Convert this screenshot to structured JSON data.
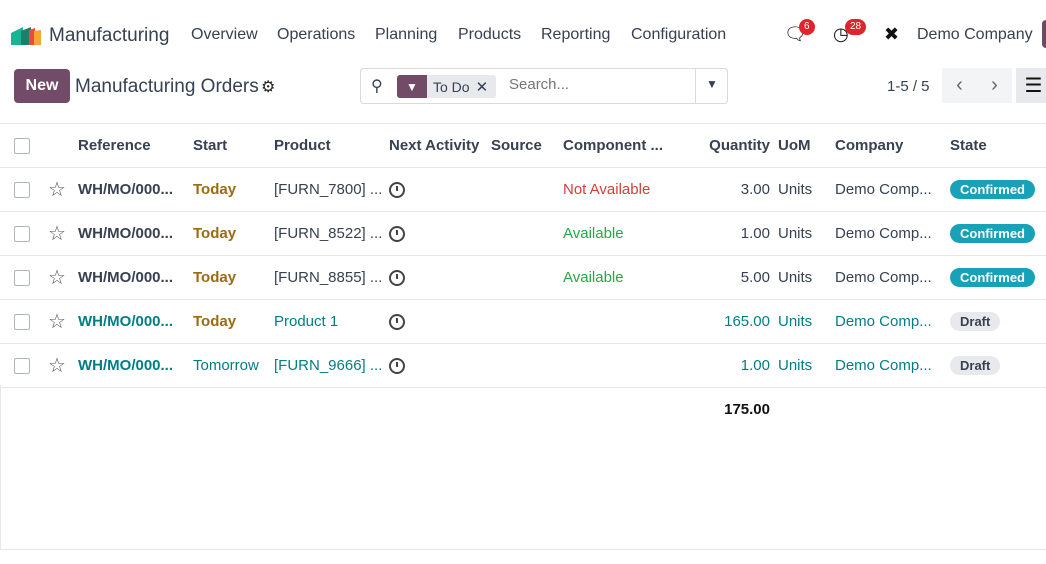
{
  "nav": {
    "app": "Manufacturing",
    "menu": [
      "Overview",
      "Operations",
      "Planning",
      "Products",
      "Reporting",
      "Configuration"
    ],
    "messages_count": "6",
    "activities_count": "28",
    "company": "Demo Company"
  },
  "control": {
    "new": "New",
    "title": "Manufacturing Orders",
    "facet": "To Do",
    "search_placeholder": "Search...",
    "pager": "1-5 / 5"
  },
  "columns": [
    "Reference",
    "Start",
    "Product",
    "Next Activity",
    "Source",
    "Component ...",
    "Quantity",
    "UoM",
    "Company",
    "State"
  ],
  "rows": [
    {
      "ref": "WH/MO/000...",
      "start": "Today",
      "product": "[FURN_7800] ...",
      "component": "Not Available",
      "qty": "3.00",
      "uom": "Units",
      "company": "Demo Comp...",
      "state": "Confirmed"
    },
    {
      "ref": "WH/MO/000...",
      "start": "Today",
      "product": "[FURN_8522] ...",
      "component": "Available",
      "qty": "1.00",
      "uom": "Units",
      "company": "Demo Comp...",
      "state": "Confirmed"
    },
    {
      "ref": "WH/MO/000...",
      "start": "Today",
      "product": "[FURN_8855] ...",
      "component": "Available",
      "qty": "5.00",
      "uom": "Units",
      "company": "Demo Comp...",
      "state": "Confirmed"
    },
    {
      "ref": "WH/MO/000...",
      "start": "Today",
      "product": "Product 1",
      "component": "",
      "qty": "165.00",
      "uom": "Units",
      "company": "Demo Comp...",
      "state": "Draft"
    },
    {
      "ref": "WH/MO/000...",
      "start": "Tomorrow",
      "product": "[FURN_9666] ...",
      "component": "",
      "qty": "1.00",
      "uom": "Units",
      "company": "Demo Comp...",
      "state": "Draft"
    }
  ],
  "total_quantity": "175.00",
  "colors": {
    "brand": "#714b67",
    "confirmed": "#17a2b8",
    "draft": "#e7e9ed",
    "badge": "#e0242e"
  }
}
